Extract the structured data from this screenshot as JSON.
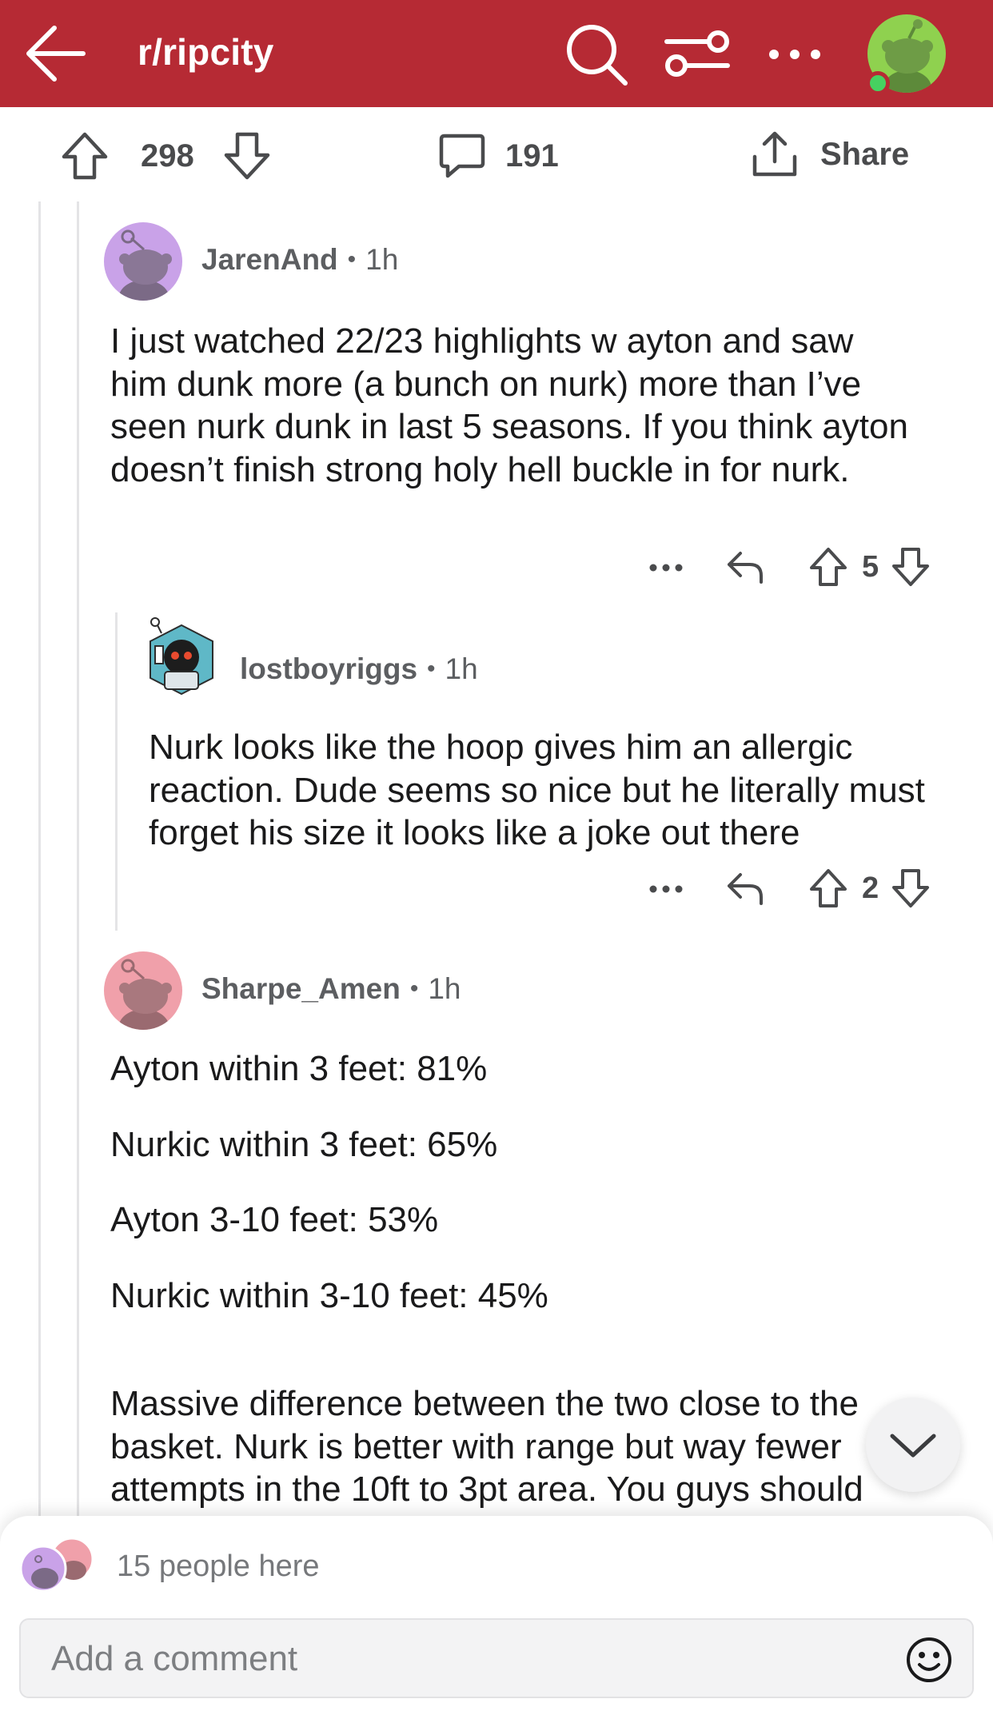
{
  "header": {
    "subreddit": "r/ripcity",
    "back_icon": "back-arrow-icon",
    "search_icon": "search-icon",
    "filter_icon": "filter-sliders-icon",
    "more_icon": "more-dots-icon",
    "avatar_bg": "#8fd14f",
    "bg_color": "#b62a34"
  },
  "post_actions": {
    "upvotes": "298",
    "comments": "191",
    "share_label": "Share"
  },
  "comments": [
    {
      "username": "JarenAnd",
      "time": "1h",
      "avatar_color": "#c9a2e8",
      "body": "I just watched 22/23 highlights w ayton and saw him dunk more (a bunch on nurk) more than I’ve seen nurk dunk in last 5 seasons.  If you think ayton doesn’t finish strong holy hell buckle in for nurk.",
      "score": "5"
    },
    {
      "username": "lostboyriggs",
      "time": "1h",
      "avatar_color": "#3aa3a3",
      "body": "Nurk looks like the hoop gives him an allergic reaction. Dude seems so nice but he literally must forget his size it looks like a joke out there",
      "score": "2"
    },
    {
      "username": "Sharpe_Amen",
      "time": "1h",
      "avatar_color": "#f0a0aa",
      "paragraphs": [
        "Ayton within 3 feet: 81%",
        "Nurkic within 3 feet: 65%",
        "Ayton 3-10 feet: 53%",
        "Nurkic within 3-10 feet: 45%",
        "Massive difference between the two close to the basket. Nurk is better with range but way fewer attempts in the 10ft to 3pt area. You guys should"
      ]
    }
  ],
  "composer": {
    "people_here": "15 people here",
    "placeholder": "Add a comment",
    "emoji_icon": "emoji-smile-icon"
  }
}
